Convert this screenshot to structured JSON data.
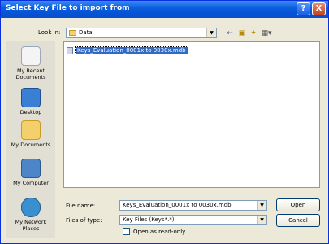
{
  "window": {
    "title": "Select Key File to import from",
    "help_label": "?",
    "close_label": "X"
  },
  "toolbar": {
    "look_in_label": "Look in:",
    "look_in_value": "Data",
    "back_icon": "back-arrow-icon",
    "up_icon": "up-folder-icon",
    "new_folder_icon": "new-folder-icon",
    "views_icon": "views-menu-icon"
  },
  "places": [
    {
      "label": "My Recent Documents",
      "icon": "recent-documents-icon"
    },
    {
      "label": "Desktop",
      "icon": "desktop-icon"
    },
    {
      "label": "My Documents",
      "icon": "my-documents-icon"
    },
    {
      "label": "My Computer",
      "icon": "my-computer-icon"
    },
    {
      "label": "My Network Places",
      "icon": "network-places-icon"
    }
  ],
  "files": [
    {
      "name": "Keys_Evaluation_0001x to 0030x.mdb",
      "selected": true
    }
  ],
  "bottom": {
    "file_name_label": "File name:",
    "file_name_value": "Keys_Evaluation_0001x to 0030x.mdb",
    "files_of_type_label": "Files of type:",
    "files_of_type_value": "Key Files (Keys*.*)",
    "open_label": "Open",
    "cancel_label": "Cancel",
    "read_only_label": "Open as read-only"
  }
}
